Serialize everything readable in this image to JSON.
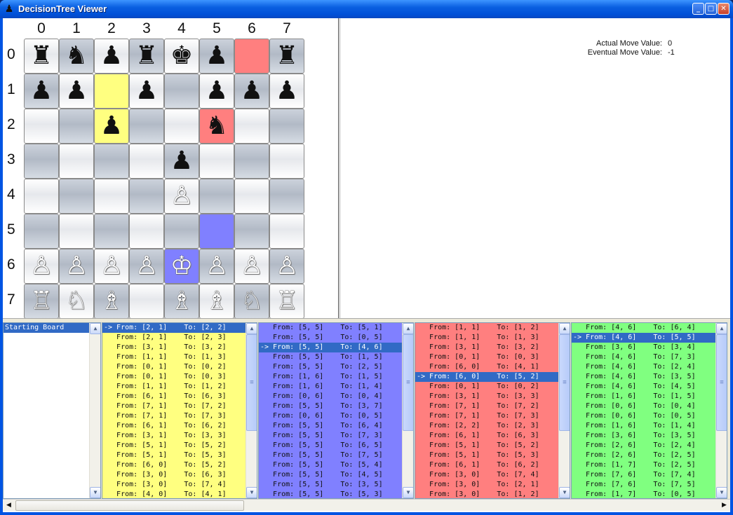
{
  "window": {
    "title": "DecisionTree Viewer",
    "app_icon": "pawn-icon",
    "minimize": "_",
    "maximize": "□",
    "close": "✕"
  },
  "board": {
    "columns": [
      "0",
      "1",
      "2",
      "3",
      "4",
      "5",
      "6",
      "7"
    ],
    "rows": [
      "0",
      "1",
      "2",
      "3",
      "4",
      "5",
      "6",
      "7"
    ],
    "pieces": [
      [
        "♜",
        "♞",
        "♟",
        "♜",
        "♚",
        "♟",
        "",
        "♜"
      ],
      [
        "♟",
        "♟",
        "",
        "♟",
        "",
        "♟",
        "♟",
        "♟"
      ],
      [
        "",
        "",
        "♟",
        "",
        "",
        "♞",
        "",
        ""
      ],
      [
        "",
        "",
        "",
        "",
        "♟",
        "",
        "",
        ""
      ],
      [
        "",
        "",
        "",
        "",
        "♙",
        "",
        "",
        ""
      ],
      [
        "",
        "",
        "",
        "",
        "",
        "",
        "",
        ""
      ],
      [
        "♙",
        "♙",
        "♙",
        "♙",
        "♔",
        "♙",
        "♙",
        "♙"
      ],
      [
        "♖",
        "♘",
        "♗",
        "",
        "♗",
        "♗",
        "♘",
        "♖"
      ]
    ],
    "piece_colors": [
      [
        "b",
        "b",
        "b",
        "b",
        "b",
        "b",
        "",
        "b"
      ],
      [
        "b",
        "b",
        "",
        "b",
        "",
        "b",
        "b",
        "b"
      ],
      [
        "",
        "",
        "b",
        "",
        "",
        "b",
        "",
        ""
      ],
      [
        "",
        "",
        "",
        "",
        "b",
        "",
        "",
        ""
      ],
      [
        "",
        "",
        "",
        "",
        "w",
        "",
        "",
        ""
      ],
      [
        "",
        "",
        "",
        "",
        "",
        "",
        "",
        ""
      ],
      [
        "w",
        "w",
        "w",
        "w",
        "w",
        "w",
        "w",
        "w"
      ],
      [
        "w",
        "w",
        "w",
        "",
        "w",
        "w",
        "w",
        "w"
      ]
    ],
    "highlights": [
      {
        "row": 0,
        "col": 6,
        "color": "red"
      },
      {
        "row": 2,
        "col": 5,
        "color": "red"
      },
      {
        "row": 1,
        "col": 2,
        "color": "yellow"
      },
      {
        "row": 2,
        "col": 2,
        "color": "yellow"
      },
      {
        "row": 6,
        "col": 4,
        "color": "blue"
      },
      {
        "row": 5,
        "col": 5,
        "color": "blue"
      }
    ]
  },
  "info": {
    "actual_label": "Actual Move Value:",
    "actual_value": "0",
    "eventual_label": "Eventual Move Value:",
    "eventual_value": "-1"
  },
  "colors": {
    "yellow": "#ffff80",
    "blue": "#8080ff",
    "red": "#ff7f7f",
    "green": "#80ff80",
    "selection": "#316ac5"
  },
  "lists": [
    {
      "name": "history-list",
      "bg": "#ffffff",
      "rows": [
        "Starting Board"
      ],
      "selected": 0,
      "scroll_fraction": 0
    },
    {
      "name": "yellow-move-list",
      "bg": "#ffff80",
      "selected": 0,
      "scroll_fraction": 0.0,
      "rows": [
        "-> From: [2, 1]    To: [2, 2]",
        "   From: [2, 1]    To: [2, 3]",
        "   From: [3, 1]    To: [3, 2]",
        "   From: [1, 1]    To: [1, 3]",
        "   From: [0, 1]    To: [0, 2]",
        "   From: [0, 1]    To: [0, 3]",
        "   From: [1, 1]    To: [1, 2]",
        "   From: [6, 1]    To: [6, 3]",
        "   From: [7, 1]    To: [7, 2]",
        "   From: [7, 1]    To: [7, 3]",
        "   From: [6, 1]    To: [6, 2]",
        "   From: [3, 1]    To: [3, 3]",
        "   From: [5, 1]    To: [5, 2]",
        "   From: [5, 1]    To: [5, 3]",
        "   From: [6, 0]    To: [5, 2]",
        "   From: [3, 0]    To: [6, 3]",
        "   From: [3, 0]    To: [7, 4]",
        "   From: [4, 0]    To: [4, 1]"
      ]
    },
    {
      "name": "blue-move-list",
      "bg": "#8080ff",
      "selected": 2,
      "scroll_fraction": 0.0,
      "rows": [
        "   From: [5, 5]    To: [5, 1]",
        "   From: [5, 5]    To: [0, 5]",
        "-> From: [5, 5]    To: [4, 6]",
        "   From: [5, 5]    To: [1, 5]",
        "   From: [5, 5]    To: [2, 5]",
        "   From: [1, 6]    To: [1, 5]",
        "   From: [1, 6]    To: [1, 4]",
        "   From: [0, 6]    To: [0, 4]",
        "   From: [5, 5]    To: [3, 7]",
        "   From: [0, 6]    To: [0, 5]",
        "   From: [5, 5]    To: [6, 4]",
        "   From: [5, 5]    To: [7, 3]",
        "   From: [5, 5]    To: [6, 5]",
        "   From: [5, 5]    To: [7, 5]",
        "   From: [5, 5]    To: [5, 4]",
        "   From: [5, 5]    To: [4, 5]",
        "   From: [5, 5]    To: [3, 5]",
        "   From: [5, 5]    To: [5, 3]"
      ]
    },
    {
      "name": "red-move-list",
      "bg": "#ff7f7f",
      "selected": 5,
      "scroll_fraction": 0.0,
      "rows": [
        "   From: [1, 1]    To: [1, 2]",
        "   From: [1, 1]    To: [1, 3]",
        "   From: [3, 1]    To: [3, 2]",
        "   From: [0, 1]    To: [0, 3]",
        "   From: [6, 0]    To: [4, 1]",
        "-> From: [6, 0]    To: [5, 2]",
        "   From: [0, 1]    To: [0, 2]",
        "   From: [3, 1]    To: [3, 3]",
        "   From: [7, 1]    To: [7, 2]",
        "   From: [7, 1]    To: [7, 3]",
        "   From: [2, 2]    To: [2, 3]",
        "   From: [6, 1]    To: [6, 3]",
        "   From: [5, 1]    To: [5, 2]",
        "   From: [5, 1]    To: [5, 3]",
        "   From: [6, 1]    To: [6, 2]",
        "   From: [3, 0]    To: [7, 4]",
        "   From: [3, 0]    To: [2, 1]",
        "   From: [3, 0]    To: [1, 2]"
      ]
    },
    {
      "name": "green-move-list",
      "bg": "#80ff80",
      "selected": 1,
      "scroll_fraction": 0.0,
      "rows": [
        "   From: [4, 6]    To: [6, 4]",
        "-> From: [4, 6]    To: [5, 5]",
        "   From: [3, 6]    To: [3, 4]",
        "   From: [4, 6]    To: [7, 3]",
        "   From: [4, 6]    To: [2, 4]",
        "   From: [4, 6]    To: [3, 5]",
        "   From: [4, 6]    To: [4, 5]",
        "   From: [1, 6]    To: [1, 5]",
        "   From: [0, 6]    To: [0, 4]",
        "   From: [0, 6]    To: [0, 5]",
        "   From: [1, 6]    To: [1, 4]",
        "   From: [3, 6]    To: [3, 5]",
        "   From: [2, 6]    To: [2, 4]",
        "   From: [2, 6]    To: [2, 5]",
        "   From: [1, 7]    To: [2, 5]",
        "   From: [7, 6]    To: [7, 4]",
        "   From: [7, 6]    To: [7, 5]",
        "   From: [1, 7]    To: [0, 5]"
      ]
    }
  ],
  "scroll_icons": {
    "up": "▲",
    "down": "▼",
    "left": "◀",
    "right": "▶",
    "grip": "≡"
  }
}
